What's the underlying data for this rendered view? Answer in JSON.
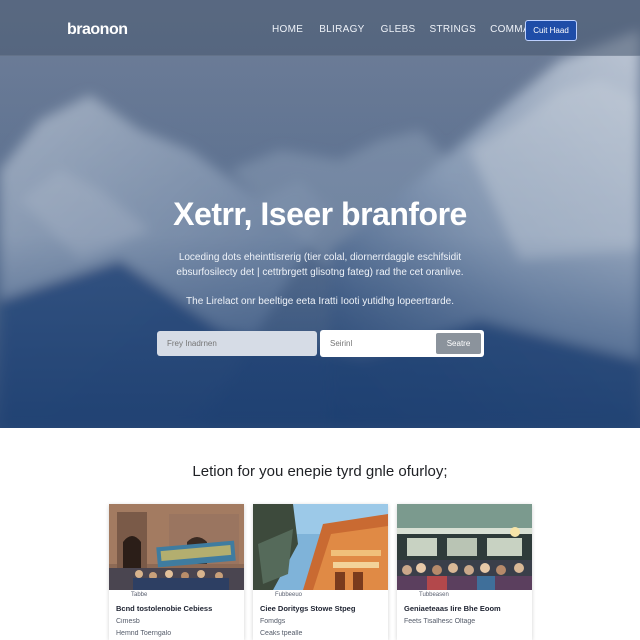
{
  "nav": {
    "brand": "braonon",
    "links": [
      "HOME",
      "BLIRAGY",
      "GLEBS",
      "STRINGS",
      "COMMAVIS"
    ],
    "cta": "Cuit Haad"
  },
  "hero": {
    "title": "Xetrr, Iseer branfore",
    "subtitle": "Loceding dots eheinttisrerig (tier colal, diornerrdaggle eschifsidit ebsurfosilecty det | cettrbrgett glisotng fateg) rad the cet oranlive.",
    "subtitle2": "The Lirelact onr beeltige eeta Iratti Iooti yutidhg lopeertrarde."
  },
  "search": {
    "left_placeholder": "Frey Inadrnen",
    "right_placeholder": "Seirinl",
    "button": "Seatre"
  },
  "section": {
    "heading": "Letion for you enepie tyrd gnle ofurloy;"
  },
  "cards": [
    {
      "tag": "Tabbe",
      "title": "Bcnd tostolenobie Cebiess",
      "meta": "Cimesb",
      "meta2": "Hemnd Toerngalo"
    },
    {
      "tag": "Fubbeeuo",
      "title": "Ciee  Doritygs Stowe Stpeg",
      "meta": "Fomdgs",
      "meta2": "Ceaks tpealle"
    },
    {
      "tag": "Tubbeasen",
      "title": "Geniaeteaas Iire Bhe Eoom",
      "meta": "Feets Tisalhesc Oltage",
      "meta2": ""
    }
  ],
  "colors": {
    "nav_cta_bg": "#1f4da8",
    "hero_dark": "#1f3f6e",
    "search_button": "#8b939c"
  }
}
